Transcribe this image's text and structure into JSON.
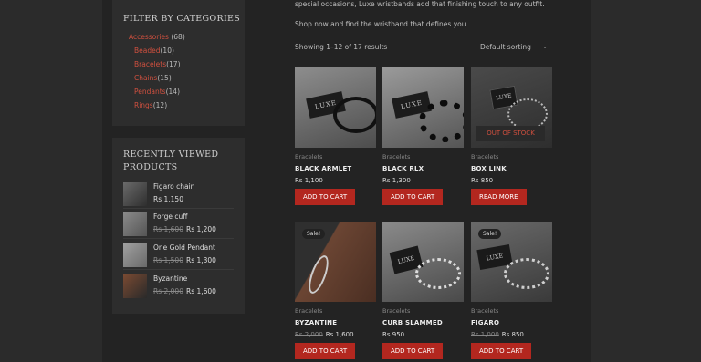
{
  "filter": {
    "title": "FILTER BY CATEGORIES",
    "parent": {
      "name": "Accessories",
      "count": "(68)"
    },
    "children": [
      {
        "name": "Beaded",
        "count": "(10)"
      },
      {
        "name": "Bracelets",
        "count": "(17)"
      },
      {
        "name": "Chains",
        "count": "(15)"
      },
      {
        "name": "Pendants",
        "count": "(14)"
      },
      {
        "name": "Rings",
        "count": "(12)"
      }
    ]
  },
  "recent": {
    "title_line1": "RECENTLY VIEWED",
    "title_line2": "PRODUCTS",
    "items": [
      {
        "name": "Figaro chain",
        "old": "",
        "price": "Rs 1,150"
      },
      {
        "name": "Forge cuff",
        "old": "Rs 1,600",
        "price": "Rs 1,200"
      },
      {
        "name": "One Gold Pendant",
        "old": "Rs 1,500",
        "price": "Rs 1,300"
      },
      {
        "name": "Byzantine",
        "old": "Rs 2,000",
        "price": "Rs 1,600"
      }
    ]
  },
  "intro": {
    "line1": "special occasions, Luxe wristbands add that finishing touch to any outfit.",
    "line2": "Shop now and find the wristband that defines you."
  },
  "shop": {
    "result_count": "Showing 1–12 of 17 results",
    "sorting": "Default sorting"
  },
  "products": [
    {
      "category": "Bracelets",
      "name": "BLACK ARMLET",
      "old": "",
      "price": "Rs 1,100",
      "button": "ADD TO CART",
      "badge": "",
      "overlay": ""
    },
    {
      "category": "Bracelets",
      "name": "BLACK RLX",
      "old": "",
      "price": "Rs 1,300",
      "button": "ADD TO CART",
      "badge": "",
      "overlay": ""
    },
    {
      "category": "Bracelets",
      "name": "BOX LINK",
      "old": "",
      "price": "Rs 850",
      "button": "READ MORE",
      "badge": "",
      "overlay": "OUT OF STOCK"
    },
    {
      "category": "Bracelets",
      "name": "BYZANTINE",
      "old": "Rs 2,000",
      "price": "Rs 1,600",
      "button": "ADD TO CART",
      "badge": "Sale!",
      "overlay": ""
    },
    {
      "category": "Bracelets",
      "name": "CURB SLAMMED",
      "old": "",
      "price": "Rs 950",
      "button": "ADD TO CART",
      "badge": "",
      "overlay": ""
    },
    {
      "category": "Bracelets",
      "name": "FIGARO",
      "old": "Rs 1,000",
      "price": "Rs 850",
      "button": "ADD TO CART",
      "badge": "Sale!",
      "overlay": ""
    }
  ],
  "brand_card": "LUXE",
  "colors": {
    "accent": "#b3271f",
    "link": "#d0503f"
  }
}
